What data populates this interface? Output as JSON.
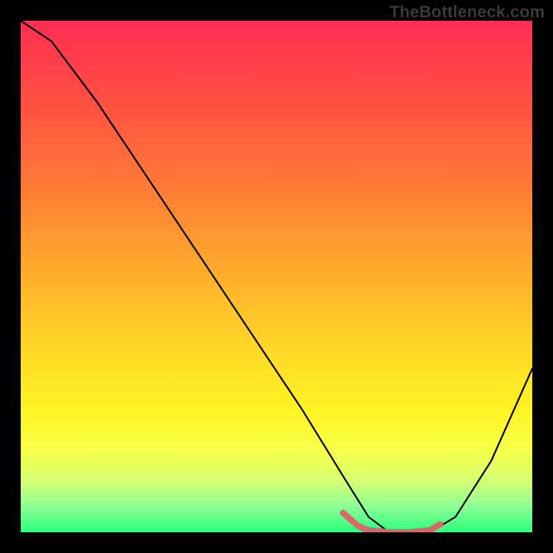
{
  "watermark": "TheBottleneck.com",
  "chart_data": {
    "type": "line",
    "title": "",
    "xlabel": "",
    "ylabel": "",
    "xlim": [
      0,
      100
    ],
    "ylim": [
      0,
      100
    ],
    "series": [
      {
        "name": "curve",
        "x": [
          0,
          6,
          15,
          25,
          35,
          45,
          55,
          63,
          68,
          72,
          76,
          80,
          85,
          92,
          100
        ],
        "values": [
          100,
          96,
          84,
          69,
          54,
          39,
          24,
          11,
          3,
          0,
          0,
          0,
          3,
          14,
          32
        ]
      }
    ],
    "highlight_segment": {
      "name": "bottom-highlight",
      "color": "#d66a6a",
      "x": [
        63,
        66,
        68,
        72,
        76,
        80,
        82
      ],
      "values": [
        3.8,
        1.2,
        0.4,
        0,
        0,
        0.4,
        1.6
      ]
    }
  }
}
